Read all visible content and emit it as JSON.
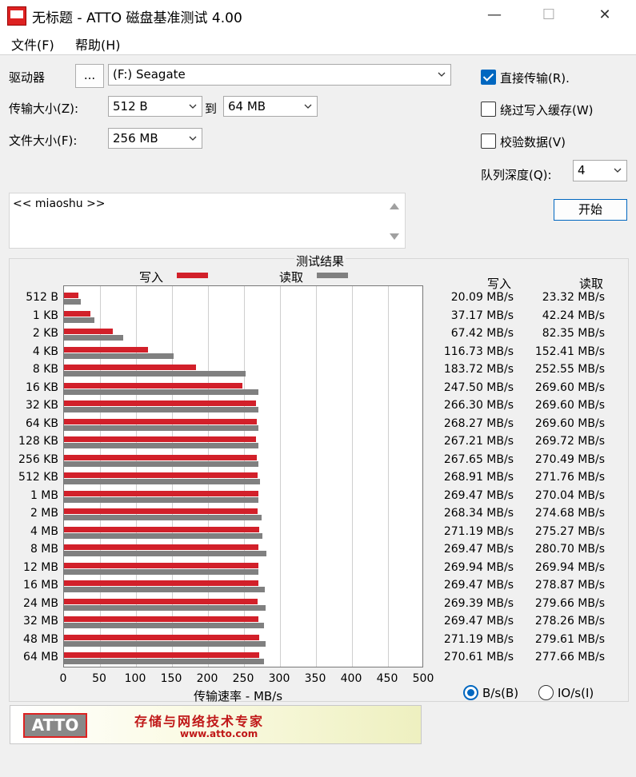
{
  "window": {
    "title": "无标题 - ATTO 磁盘基准测试 4.00",
    "minimize_glyph": "—",
    "maximize_glyph": "☐",
    "close_glyph": "✕"
  },
  "menu": {
    "file": "文件(F)",
    "help": "帮助(H)"
  },
  "settings": {
    "drive_label": "驱动器",
    "browse_label": "...",
    "drive_value": "(F:) Seagate",
    "transfer_label": "传输大小(Z):",
    "transfer_from": "512 B",
    "to_label": "到",
    "transfer_to": "64 MB",
    "file_size_label": "文件大小(F):",
    "file_size_value": "256 MB",
    "direct_io_label": "直接传输(R).",
    "direct_io_checked": true,
    "bypass_cache_label": "绕过写入缓存(W)",
    "bypass_cache_checked": false,
    "verify_label": "校验数据(V)",
    "verify_checked": false,
    "queue_depth_label": "队列深度(Q):",
    "queue_depth_value": "4",
    "start_label": "开始",
    "description": "<< miaoshu >>"
  },
  "results": {
    "title": "测试结果",
    "legend_write": "写入",
    "legend_read": "读取",
    "col_write": "写入",
    "col_read": "读取",
    "write_color": "#d2202a",
    "read_color": "#808080",
    "units_bytes_label": "B/s(B)",
    "units_io_label": "IO/s(I)",
    "units_selected": "bytes"
  },
  "chart_data": {
    "type": "bar",
    "orientation": "horizontal",
    "title": "测试结果",
    "xlabel": "传输速率 - MB/s",
    "ylabel": "",
    "xlim": [
      0,
      500
    ],
    "xticks": [
      "0",
      "50",
      "100",
      "150",
      "200",
      "250",
      "300",
      "350",
      "400",
      "450",
      "500"
    ],
    "grid": true,
    "legend": "top",
    "categories": [
      "512 B",
      "1 KB",
      "2 KB",
      "4 KB",
      "8 KB",
      "16 KB",
      "32 KB",
      "64 KB",
      "128 KB",
      "256 KB",
      "512 KB",
      "1 MB",
      "2 MB",
      "4 MB",
      "8 MB",
      "12 MB",
      "16 MB",
      "24 MB",
      "32 MB",
      "48 MB",
      "64 MB"
    ],
    "series": [
      {
        "name": "写入",
        "values": [
          20.09,
          37.17,
          67.42,
          116.73,
          183.72,
          247.5,
          266.3,
          268.27,
          267.21,
          267.65,
          268.91,
          269.47,
          268.34,
          271.19,
          269.47,
          269.94,
          269.47,
          269.39,
          269.47,
          271.19,
          270.61
        ],
        "labels": [
          "20.09 MB/s",
          "37.17 MB/s",
          "67.42 MB/s",
          "116.73 MB/s",
          "183.72 MB/s",
          "247.50 MB/s",
          "266.30 MB/s",
          "268.27 MB/s",
          "267.21 MB/s",
          "267.65 MB/s",
          "268.91 MB/s",
          "269.47 MB/s",
          "268.34 MB/s",
          "271.19 MB/s",
          "269.47 MB/s",
          "269.94 MB/s",
          "269.47 MB/s",
          "269.39 MB/s",
          "269.47 MB/s",
          "271.19 MB/s",
          "270.61 MB/s"
        ]
      },
      {
        "name": "读取",
        "values": [
          23.32,
          42.24,
          82.35,
          152.41,
          252.55,
          269.6,
          269.6,
          269.6,
          269.72,
          270.49,
          271.76,
          270.04,
          274.68,
          275.27,
          280.7,
          269.94,
          278.87,
          279.66,
          278.26,
          279.61,
          277.66
        ],
        "labels": [
          "23.32 MB/s",
          "42.24 MB/s",
          "82.35 MB/s",
          "152.41 MB/s",
          "252.55 MB/s",
          "269.60 MB/s",
          "269.60 MB/s",
          "269.60 MB/s",
          "269.72 MB/s",
          "270.49 MB/s",
          "271.76 MB/s",
          "270.04 MB/s",
          "274.68 MB/s",
          "275.27 MB/s",
          "280.70 MB/s",
          "269.94 MB/s",
          "278.87 MB/s",
          "279.66 MB/s",
          "278.26 MB/s",
          "279.61 MB/s",
          "277.66 MB/s"
        ]
      }
    ]
  },
  "banner": {
    "logo": "ATTO",
    "slogan": "存储与网络技术专家",
    "url": "www.atto.com"
  }
}
